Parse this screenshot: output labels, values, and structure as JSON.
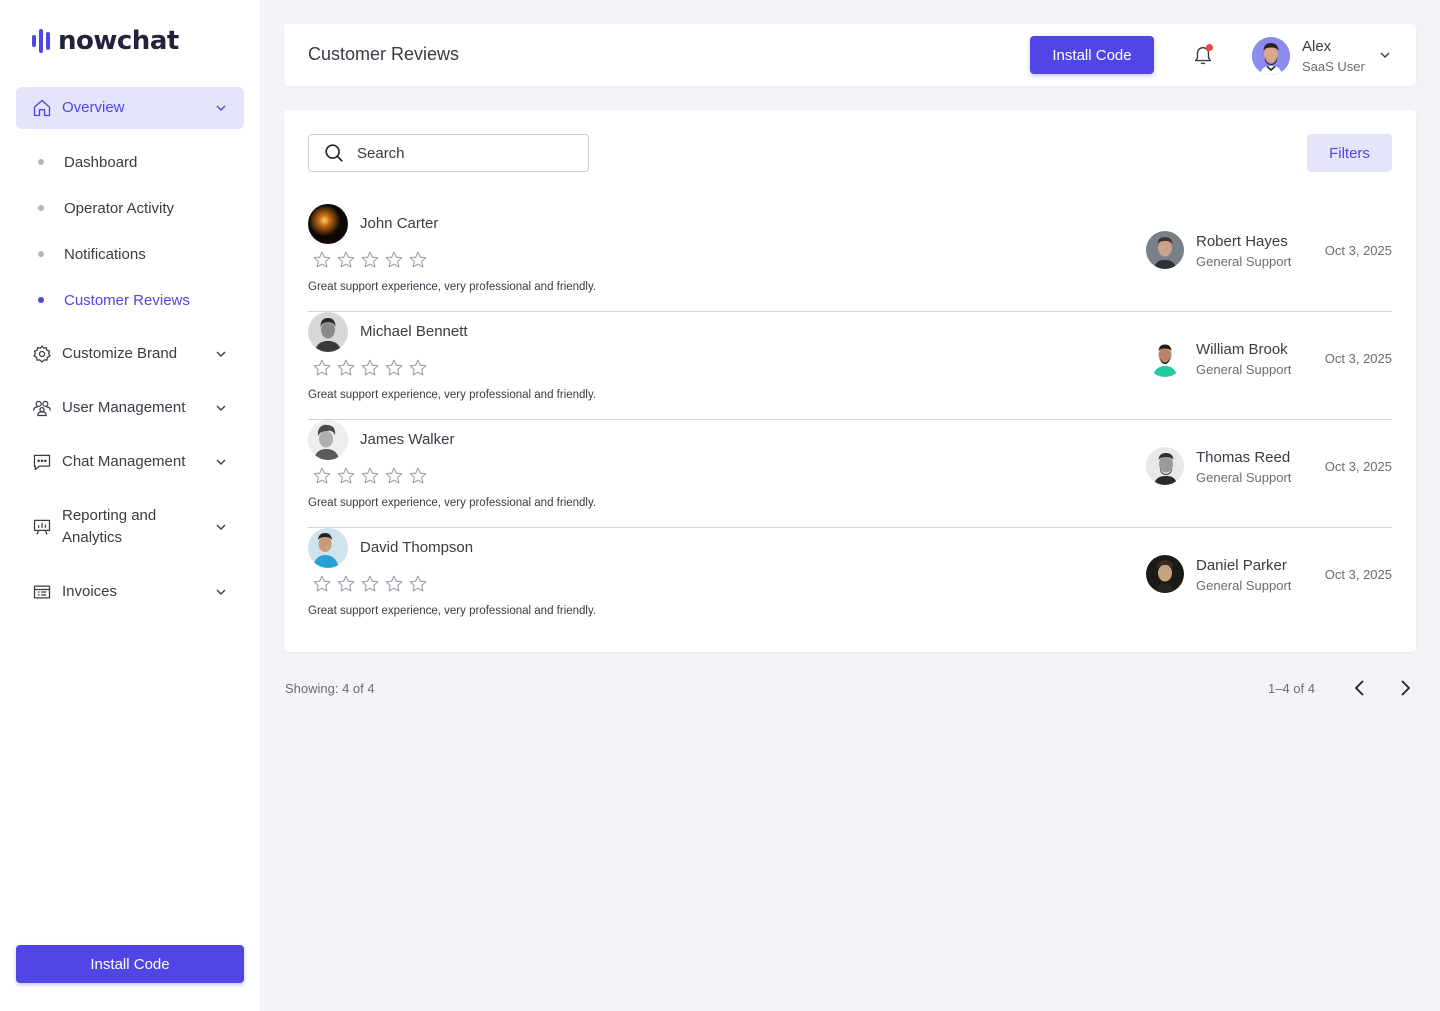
{
  "brand": {
    "name": "nowchat",
    "accent": "#4f46e5"
  },
  "sidebar": {
    "overview": {
      "label": "Overview",
      "icon": "home-icon"
    },
    "sub_items": [
      {
        "label": "Dashboard",
        "active": false
      },
      {
        "label": "Operator Activity",
        "active": false
      },
      {
        "label": "Notifications",
        "active": false
      },
      {
        "label": "Customer Reviews",
        "active": true
      }
    ],
    "groups": [
      {
        "label": "Customize Brand",
        "icon": "gear-icon"
      },
      {
        "label": "User Management",
        "icon": "users-icon"
      },
      {
        "label": "Chat Management",
        "icon": "chat-icon"
      },
      {
        "label": "Reporting and Analytics",
        "icon": "analytics-icon"
      },
      {
        "label": "Invoices",
        "icon": "invoice-icon"
      }
    ],
    "install_label": "Install Code"
  },
  "header": {
    "title": "Customer Reviews",
    "install_label": "Install Code",
    "user": {
      "name": "Alex",
      "role": "SaaS User"
    }
  },
  "toolbar": {
    "search_placeholder": "Search",
    "filters_label": "Filters"
  },
  "reviews": [
    {
      "customer": "John Carter",
      "rating": 0,
      "text": "Great support experience, very professional and friendly.",
      "agent": "Robert Hayes",
      "agent_role": "General Support",
      "date": "Oct 3, 2025"
    },
    {
      "customer": "Michael Bennett",
      "rating": 0,
      "text": "Great support experience, very professional and friendly.",
      "agent": "William Brook",
      "agent_role": "General Support",
      "date": "Oct 3, 2025"
    },
    {
      "customer": "James Walker",
      "rating": 0,
      "text": "Great support experience, very professional and friendly.",
      "agent": "Thomas Reed",
      "agent_role": "General Support",
      "date": "Oct 3, 2025"
    },
    {
      "customer": "David Thompson",
      "rating": 0,
      "text": "Great support experience, very professional and friendly.",
      "agent": "Daniel Parker",
      "agent_role": "General Support",
      "date": "Oct 3, 2025"
    }
  ],
  "pagination": {
    "showing": "Showing: 4 of 4",
    "range": "1–4 of 4"
  }
}
